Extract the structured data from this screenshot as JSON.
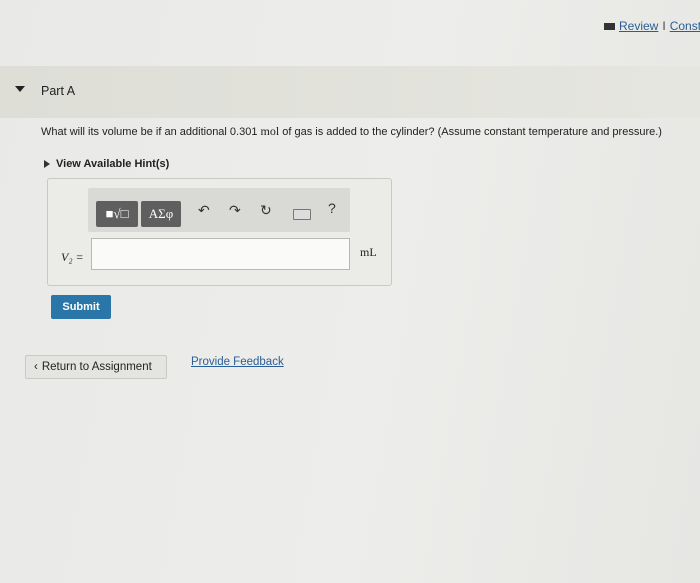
{
  "header": {
    "review_label": "Review",
    "separator": "I",
    "constants_label": "Consta"
  },
  "part": {
    "title": "Part A"
  },
  "question": {
    "prefix": "What will its volume be if an additional 0.301 ",
    "unit": "mol",
    "suffix": " of gas is added to the cylinder? (Assume constant temperature and pressure.)"
  },
  "hint": {
    "label": "View Available Hint(s)"
  },
  "toolbar": {
    "matrix_label": "■√□",
    "greek_label": "ΑΣφ",
    "undo_icon": "↶",
    "redo_icon": "↷",
    "reset_icon": "↻",
    "help_label": "?"
  },
  "answer": {
    "variable_label": "V₂ =",
    "value": "",
    "unit": "mL"
  },
  "actions": {
    "submit_label": "Submit",
    "return_label": "Return to Assignment",
    "feedback_label": "Provide Feedback"
  }
}
